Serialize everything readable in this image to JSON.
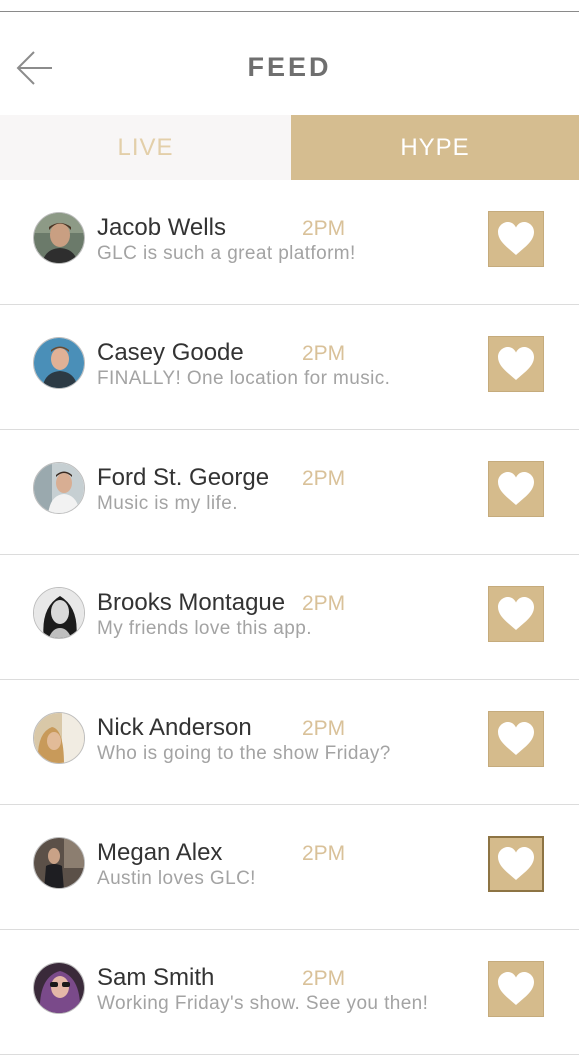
{
  "header": {
    "title": "FEED",
    "back_icon": "arrow-left-icon"
  },
  "tabs": [
    {
      "label": "LIVE",
      "active": false
    },
    {
      "label": "HYPE",
      "active": true
    }
  ],
  "colors": {
    "accent": "#d5bd90",
    "time_text": "#d9c199",
    "live_tab_text": "#e3cfa9",
    "title_text": "#6f6f6f"
  },
  "feed": [
    {
      "name": "Jacob Wells",
      "time": "2PM",
      "message": "GLC is such a great platform!",
      "like_icon": "heart-icon"
    },
    {
      "name": "Casey Goode",
      "time": "2PM",
      "message": "FINALLY! One location for music.",
      "like_icon": "heart-icon"
    },
    {
      "name": "Ford St. George",
      "time": "2PM",
      "message": "Music is my life.",
      "like_icon": "heart-icon"
    },
    {
      "name": "Brooks Montague",
      "time": "2PM",
      "message": "My friends love this app.",
      "like_icon": "heart-icon"
    },
    {
      "name": "Nick Anderson",
      "time": "2PM",
      "message": "Who is going to the show Friday?",
      "like_icon": "heart-icon"
    },
    {
      "name": "Megan Alex",
      "time": "2PM",
      "message": "Austin loves GLC!",
      "like_icon": "heart-icon"
    },
    {
      "name": "Sam Smith",
      "time": "2PM",
      "message": "Working Friday's show. See you then!",
      "like_icon": "heart-icon"
    }
  ]
}
